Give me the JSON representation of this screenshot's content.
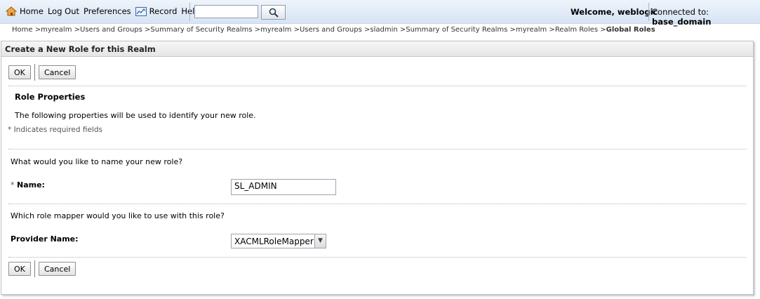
{
  "topbar": {
    "nav": [
      "Home",
      "Log Out",
      "Preferences",
      "Record",
      "Help"
    ],
    "search": {
      "value": "",
      "placeholder": ""
    },
    "welcome": "Welcome, weblogic",
    "connected_label": "Connected to:",
    "connected_domain": "base_domain"
  },
  "breadcrumb": {
    "items": [
      "Home >",
      "myrealm >",
      "Users and Groups >",
      "Summary of Security Realms >",
      "myrealm >",
      "Users and Groups >",
      "sladmin >",
      "Summary of Security Realms >",
      "myrealm >",
      "Realm Roles >"
    ],
    "current": "Global Roles"
  },
  "panel": {
    "title": "Create a New Role for this Realm",
    "ok_label": "OK",
    "cancel_label": "Cancel",
    "section_title": "Role Properties",
    "description": "The following properties will be used to identify your new role.",
    "required_note": "* Indicates required fields",
    "name_question": "What would you like to name your new role?",
    "name_required_marker": "*",
    "name_label": "Name:",
    "name_value": "SL_ADMIN",
    "mapper_question": "Which role mapper would you like to use with this role?",
    "provider_label": "Provider Name:",
    "provider_value": "XACMLRoleMapper"
  },
  "icons": [
    "home-icon",
    "record-icon",
    "search-icon",
    "chevron-down-icon"
  ]
}
